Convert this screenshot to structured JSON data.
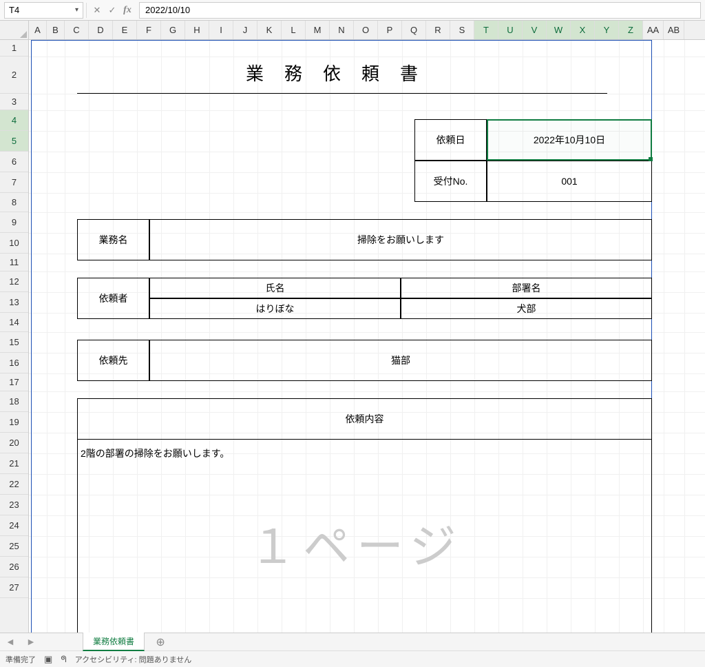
{
  "formula_bar": {
    "cell_ref": "T4",
    "formula": "2022/10/10"
  },
  "columns": [
    "A",
    "B",
    "C",
    "D",
    "E",
    "F",
    "G",
    "H",
    "I",
    "J",
    "K",
    "L",
    "M",
    "N",
    "O",
    "P",
    "Q",
    "R",
    "S",
    "T",
    "U",
    "V",
    "W",
    "X",
    "Y",
    "Z",
    "AA",
    "AB"
  ],
  "selected_columns": [
    "T",
    "U",
    "V",
    "W",
    "X",
    "Y",
    "Z"
  ],
  "rows": [
    "1",
    "2",
    "3",
    "4",
    "5",
    "6",
    "7",
    "8",
    "9",
    "10",
    "11",
    "12",
    "13",
    "14",
    "15",
    "16",
    "17",
    "18",
    "19",
    "20",
    "21",
    "22",
    "23",
    "24",
    "25",
    "26",
    "27"
  ],
  "selected_rows": [
    "4",
    "5"
  ],
  "sheet": {
    "title": "業務依頼書",
    "request_date_label": "依頼日",
    "request_date_value": "2022年10月10日",
    "receipt_no_label": "受付No.",
    "receipt_no_value": "001",
    "task_name_label": "業務名",
    "task_name_value": "掃除をお願いします",
    "requester_label": "依頼者",
    "name_header": "氏名",
    "dept_header": "部署名",
    "name_value": "はりぼな",
    "dept_value": "犬部",
    "destination_label": "依頼先",
    "destination_value": "猫部",
    "content_header": "依頼内容",
    "content_body": "2階の部署の掃除をお願いします。",
    "watermark": "１ページ"
  },
  "tabs": {
    "sheet_name": "業務依頼書"
  },
  "status": {
    "ready": "準備完了",
    "accessibility": "アクセシビリティ: 問題ありません"
  }
}
